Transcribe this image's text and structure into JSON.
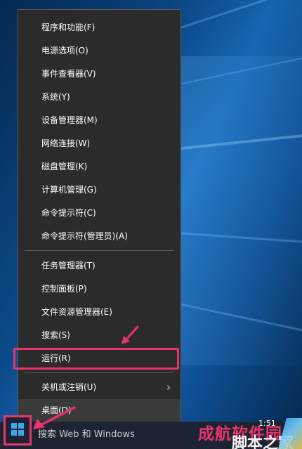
{
  "menu": {
    "items": [
      {
        "label": "程序和功能(F)"
      },
      {
        "label": "电源选项(O)"
      },
      {
        "label": "事件查看器(V)"
      },
      {
        "label": "系统(Y)"
      },
      {
        "label": "设备管理器(M)"
      },
      {
        "label": "网络连接(W)"
      },
      {
        "label": "磁盘管理(K)"
      },
      {
        "label": "计算机管理(G)"
      },
      {
        "label": "命令提示符(C)"
      },
      {
        "label": "命令提示符(管理员)(A)"
      },
      {
        "label": "任务管理器(T)"
      },
      {
        "label": "控制面板(P)"
      },
      {
        "label": "文件资源管理器(E)"
      },
      {
        "label": "搜索(S)"
      },
      {
        "label": "运行(R)"
      },
      {
        "label": "关机或注销(U)"
      },
      {
        "label": "桌面(D)"
      }
    ],
    "submenu_arrow": "›"
  },
  "taskbar": {
    "search_placeholder": "搜索 Web 和 Windows",
    "clock": "1:51"
  },
  "watermark": {
    "line1": "成航软件园",
    "line2": "脚本之家"
  },
  "colors": {
    "highlight": "#e8336d",
    "menu_bg": "#2b2b2b",
    "taskbar_bg": "#1c2431",
    "win_logo": "#3ea7f0"
  }
}
